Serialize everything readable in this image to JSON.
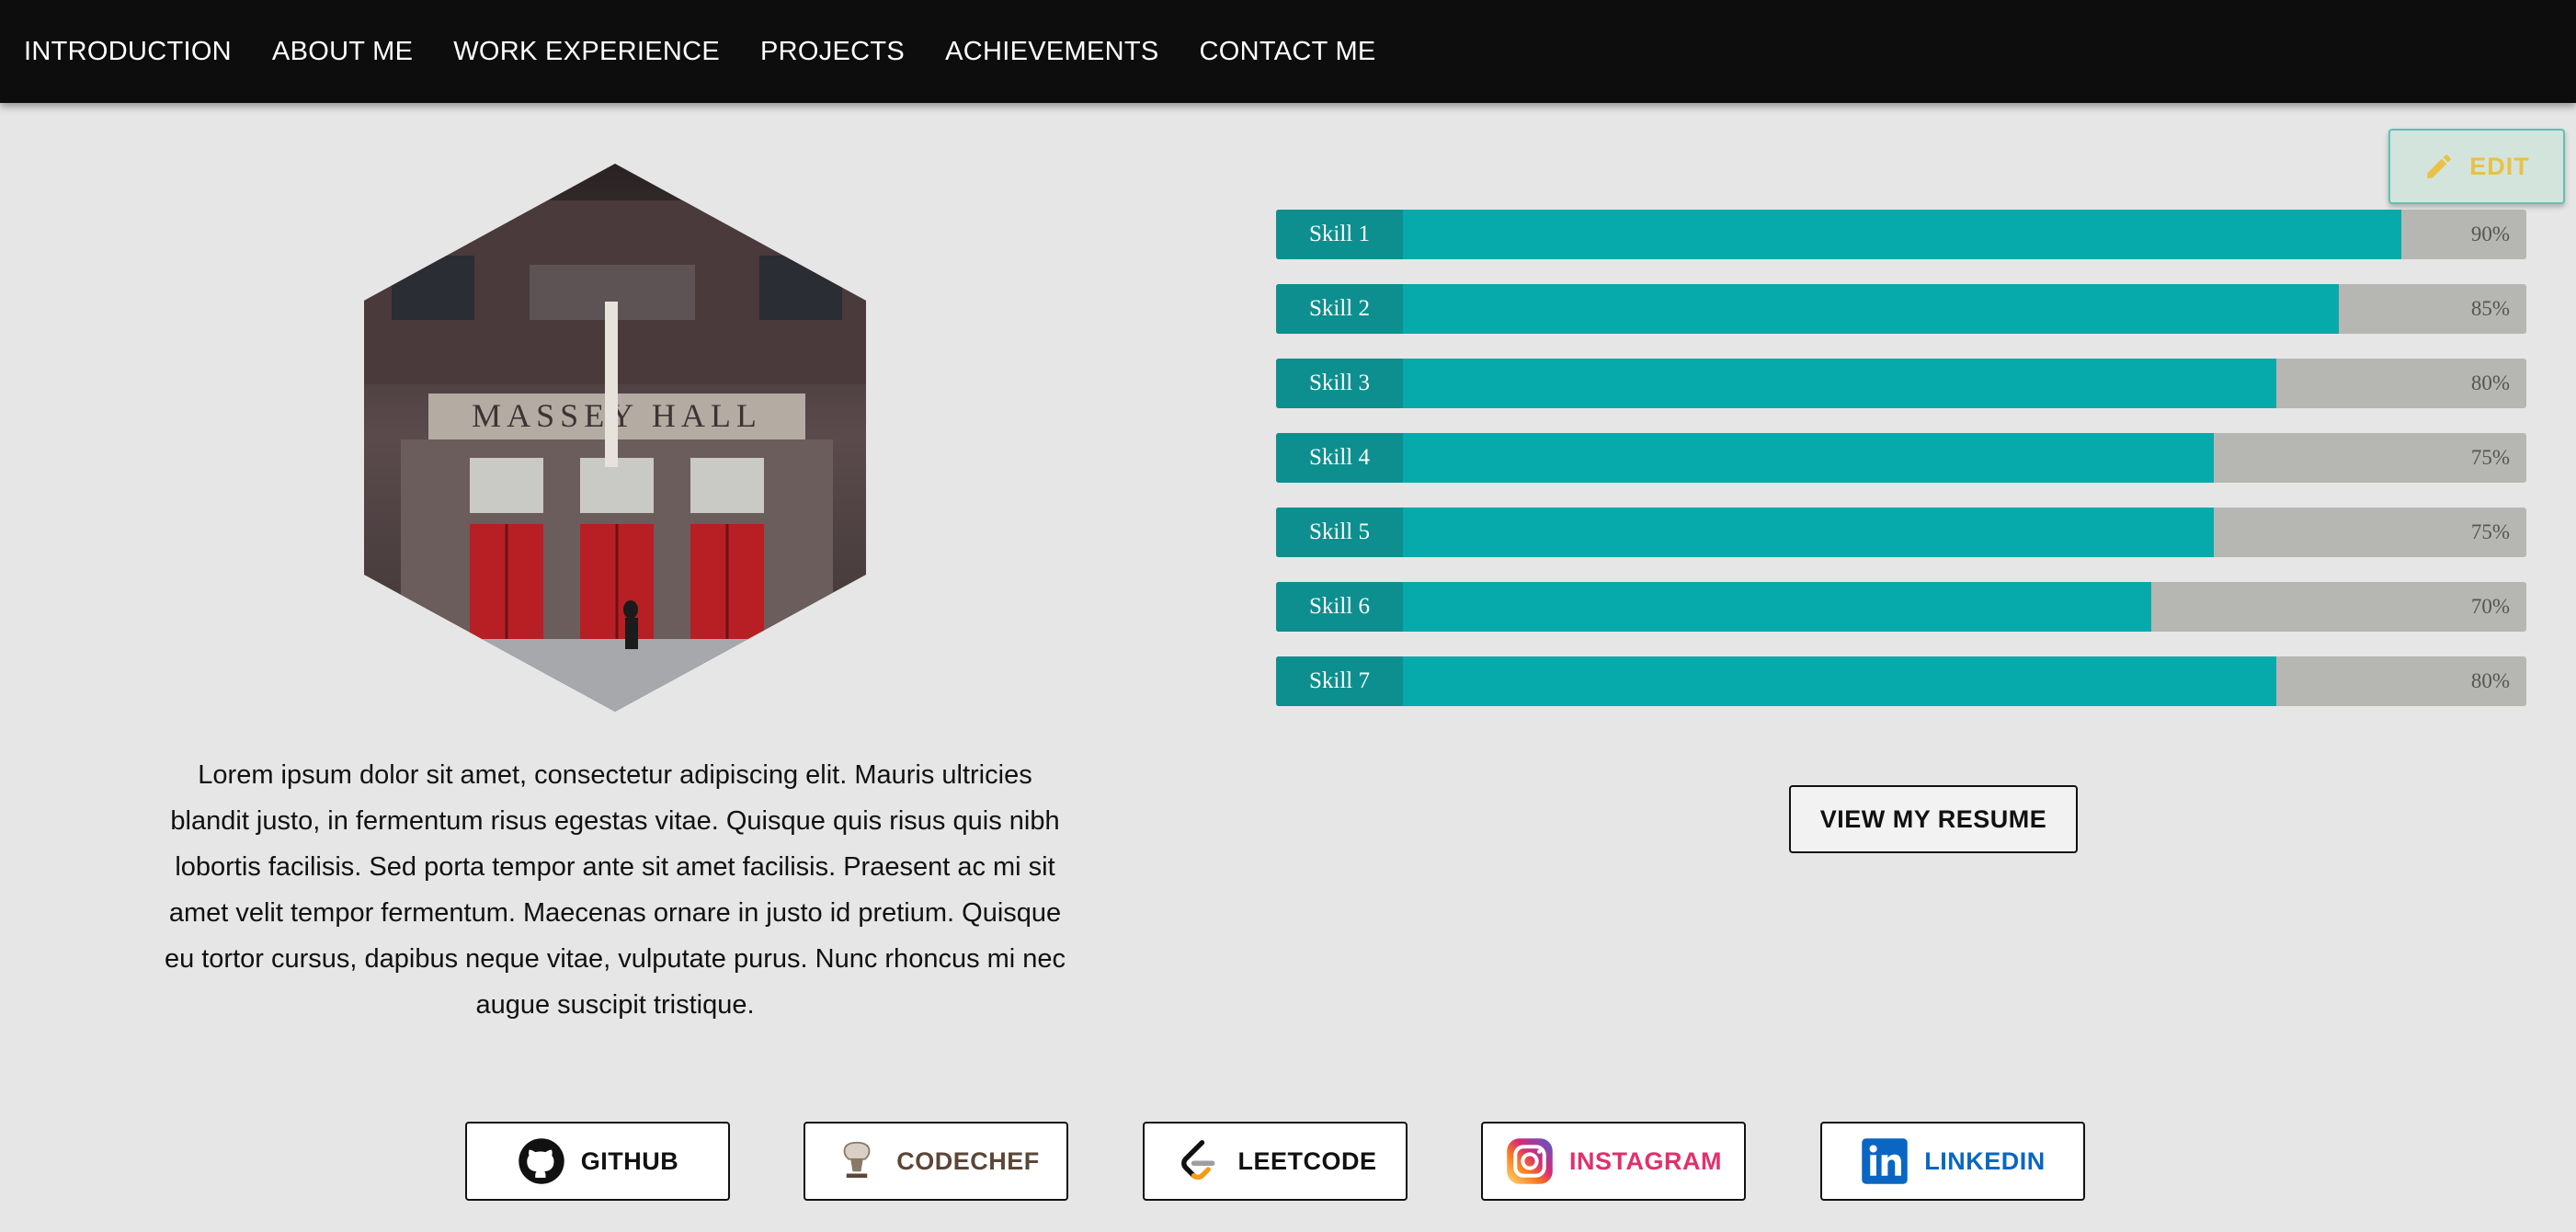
{
  "nav": {
    "items": [
      "INTRODUCTION",
      "ABOUT ME",
      "WORK EXPERIENCE",
      "PROJECTS",
      "ACHIEVEMENTS",
      "CONTACT ME"
    ]
  },
  "edit_button": {
    "label": "EDIT",
    "icon": "pencil-icon",
    "color": "#e9c146"
  },
  "profile_image": {
    "alt": "MASSEY HALL"
  },
  "about": {
    "text": "Lorem ipsum dolor sit amet, consectetur adipiscing elit. Mauris ultricies blandit justo, in fermentum risus egestas vitae. Quisque quis risus quis nibh lobortis facilisis. Sed porta tempor ante sit amet facilisis. Praesent ac mi sit amet velit tempor fermentum. Maecenas ornare in justo id pretium. Quisque eu tortor cursus, dapibus neque vitae, vulputate purus. Nunc rhoncus mi nec augue suscipit tristique."
  },
  "skills": [
    {
      "label": "Skill 1",
      "percent": "90%",
      "value": 90
    },
    {
      "label": "Skill 2",
      "percent": "85%",
      "value": 85
    },
    {
      "label": "Skill 3",
      "percent": "80%",
      "value": 80
    },
    {
      "label": "Skill 4",
      "percent": "75%",
      "value": 75
    },
    {
      "label": "Skill 5",
      "percent": "75%",
      "value": 75
    },
    {
      "label": "Skill 6",
      "percent": "70%",
      "value": 70
    },
    {
      "label": "Skill 7",
      "percent": "80%",
      "value": 80
    }
  ],
  "colors": {
    "accent": "#06aaaa",
    "accent_dark": "#0e8f8f",
    "track": "#b6b6b2"
  },
  "resume_button": {
    "label": "VIEW MY RESUME"
  },
  "social": [
    {
      "label": "GITHUB",
      "icon": "github-icon",
      "color": "#111111"
    },
    {
      "label": "CODECHEF",
      "icon": "codechef-icon",
      "color": "#5b4638"
    },
    {
      "label": "LEETCODE",
      "icon": "leetcode-icon",
      "color": "#111111"
    },
    {
      "label": "INSTAGRAM",
      "icon": "instagram-icon",
      "color": "#e1306c"
    },
    {
      "label": "LINKEDIN",
      "icon": "linkedin-icon",
      "color": "#0a66c2"
    }
  ]
}
